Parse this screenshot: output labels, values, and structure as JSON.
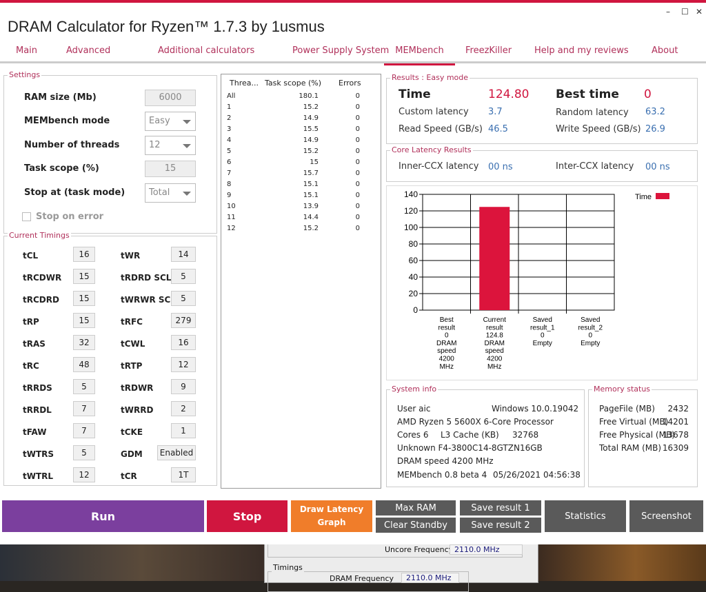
{
  "window": {
    "title": "DRAM Calculator for Ryzen™ 1.7.3 by 1usmus",
    "minimize": "–",
    "maximize": "☐",
    "close": "✕"
  },
  "tabs": [
    "Main",
    "Advanced",
    "Additional calculators",
    "Power Supply System",
    "MEMbench",
    "FreezKiller",
    "Help and my reviews",
    "About"
  ],
  "active_tab": "MEMbench",
  "settings": {
    "title": "Settings",
    "ram_size_label": "RAM size (Mb)",
    "ram_size": "6000",
    "mode_label": "MEMbench mode",
    "mode": "Easy",
    "threads_label": "Number of threads",
    "threads": "12",
    "scope_label": "Task scope (%)",
    "scope": "15",
    "stop_label": "Stop at (task mode)",
    "stop": "Total",
    "stop_on_error": "Stop on error"
  },
  "timings": {
    "title": "Current Timings",
    "rows": [
      [
        "tCL",
        "16",
        "tWR",
        "14"
      ],
      [
        "tRCDWR",
        "15",
        "tRDRD SCL",
        "5"
      ],
      [
        "tRCDRD",
        "15",
        "tWRWR SCL",
        "5"
      ],
      [
        "tRP",
        "15",
        "tRFC",
        "279"
      ],
      [
        "tRAS",
        "32",
        "tCWL",
        "16"
      ],
      [
        "tRC",
        "48",
        "tRTP",
        "12"
      ],
      [
        "tRRDS",
        "5",
        "tRDWR",
        "9"
      ],
      [
        "tRRDL",
        "7",
        "tWRRD",
        "2"
      ],
      [
        "tFAW",
        "7",
        "tCKE",
        "1"
      ],
      [
        "tWTRS",
        "5",
        "GDM",
        "Enabled"
      ],
      [
        "tWTRL",
        "12",
        "tCR",
        "1T"
      ]
    ]
  },
  "threads_table": {
    "headers": [
      "Threa...",
      "Task scope (%)",
      "Errors"
    ],
    "rows": [
      [
        "All",
        "180.1",
        "0"
      ],
      [
        "1",
        "15.2",
        "0"
      ],
      [
        "2",
        "14.9",
        "0"
      ],
      [
        "3",
        "15.5",
        "0"
      ],
      [
        "4",
        "14.9",
        "0"
      ],
      [
        "5",
        "15.2",
        "0"
      ],
      [
        "6",
        "15",
        "0"
      ],
      [
        "7",
        "15.7",
        "0"
      ],
      [
        "8",
        "15.1",
        "0"
      ],
      [
        "9",
        "15.1",
        "0"
      ],
      [
        "10",
        "13.9",
        "0"
      ],
      [
        "11",
        "14.4",
        "0"
      ],
      [
        "12",
        "15.2",
        "0"
      ]
    ]
  },
  "results": {
    "title": "Results : Easy mode",
    "time_label": "Time",
    "time": "124.80",
    "best_label": "Best time",
    "best": "0",
    "custom_label": "Custom latency",
    "custom": "3.7",
    "random_label": "Random latency",
    "random": "63.2",
    "read_label": "Read Speed (GB/s)",
    "read": "46.5",
    "write_label": "Write Speed (GB/s)",
    "write": "26.9"
  },
  "core_latency": {
    "title": "Core Latency Results",
    "inner_label": "Inner-CCX latency",
    "inner": "00 ns",
    "inter_label": "Inter-CCX latency",
    "inter": "00 ns"
  },
  "chart_data": {
    "type": "bar",
    "categories": [
      [
        "Best",
        "result",
        "0",
        "DRAM",
        "speed",
        "4200",
        "MHz"
      ],
      [
        "Current",
        "result",
        "124.8",
        "DRAM",
        "speed",
        "4200",
        "MHz"
      ],
      [
        "Saved",
        "result_1",
        "0",
        "Empty"
      ],
      [
        "Saved",
        "result_2",
        "0",
        "Empty"
      ]
    ],
    "values": [
      0,
      124.8,
      0,
      0
    ],
    "ylim": [
      0,
      140
    ],
    "yticks": [
      "0",
      "20",
      "40",
      "60",
      "80",
      "100",
      "120",
      "140"
    ],
    "legend": "Time",
    "legend_placement": "top-right",
    "color": "#dc143c"
  },
  "system_info": {
    "title": "System info",
    "user": "User aic",
    "os": "Windows 10.0.19042",
    "cpu": "AMD Ryzen 5 5600X 6-Core Processor",
    "cores": "Cores 6",
    "l3_label": "L3 Cache (KB)",
    "l3": "32768",
    "dimm": "Unknown F4-3800C14-8GTZN16GB",
    "dram": "DRAM speed 4200 MHz",
    "version": "MEMbench 0.8 beta 4",
    "datetime": "05/26/2021 04:56:38"
  },
  "memory_status": {
    "title": "Memory status",
    "rows": [
      [
        "PageFile (MB)",
        "2432"
      ],
      [
        "Free Virtual (MB)",
        "14201"
      ],
      [
        "Free Physical (MB)",
        "13678"
      ],
      [
        "Total RAM (MB)",
        "16309"
      ]
    ]
  },
  "buttons": {
    "run": "Run",
    "stop": "Stop",
    "draw": "Draw Latency Graph",
    "max_ram": "Max RAM",
    "clear_standby": "Clear Standby",
    "save1": "Save result 1",
    "save2": "Save result 2",
    "statistics": "Statistics",
    "screenshot": "Screenshot"
  },
  "background_window": {
    "uncore_label": "Uncore Frequency",
    "uncore": "2110.0 MHz",
    "timings_title": "Timings",
    "dram_label": "DRAM Frequency",
    "dram": "2110.0 MHz"
  }
}
